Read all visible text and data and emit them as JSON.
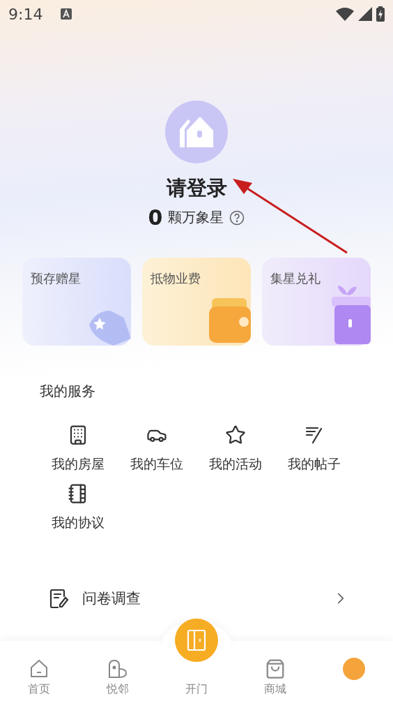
{
  "status_bar": {
    "time": "9:14"
  },
  "profile": {
    "title": "请登录",
    "count": "0",
    "unit": "颗万象星"
  },
  "cards": [
    {
      "kind": "wallet-star",
      "label": "预存赠星"
    },
    {
      "kind": "wallet",
      "label": "抵物业费"
    },
    {
      "kind": "gift",
      "label": "集星兑礼"
    }
  ],
  "services": {
    "title": "我的服务",
    "items": [
      {
        "kind": "building",
        "label": "我的房屋"
      },
      {
        "kind": "car",
        "label": "我的车位"
      },
      {
        "kind": "star",
        "label": "我的活动"
      },
      {
        "kind": "post",
        "label": "我的帖子"
      },
      {
        "kind": "agreement",
        "label": "我的协议"
      }
    ]
  },
  "list": [
    {
      "kind": "survey",
      "label": "问卷调查"
    }
  ],
  "tab_bar": [
    {
      "kind": "home",
      "label": "首页",
      "selected": false
    },
    {
      "kind": "neighbor",
      "label": "悦邻",
      "selected": false
    },
    {
      "kind": "door",
      "label": "开门",
      "selected": false
    },
    {
      "kind": "shop",
      "label": "商城",
      "selected": false
    },
    {
      "kind": "me",
      "selected": true
    }
  ],
  "annotation": {
    "kind": "arrow"
  }
}
